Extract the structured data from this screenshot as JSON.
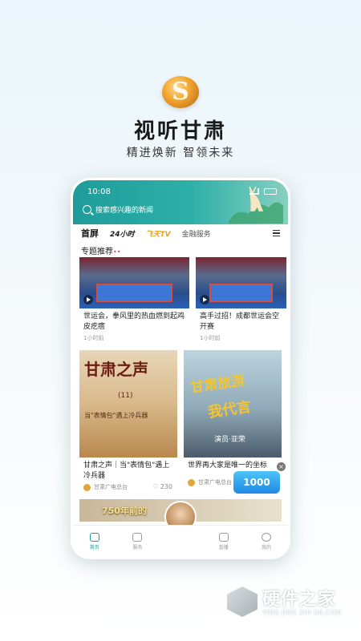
{
  "splash": {
    "app_title": "视听甘肃",
    "slogan": "精进焕新 智领未来"
  },
  "phone": {
    "status_time": "10:08",
    "search_placeholder": "搜索感兴趣的新闻",
    "tabs": [
      {
        "label": "首屏",
        "active": true
      },
      {
        "label": "24小时",
        "active": false
      },
      {
        "label": "飞天TV",
        "active": false
      },
      {
        "label": "金融服务",
        "active": false
      }
    ],
    "section_title": "专题推荐",
    "cards": [
      {
        "title": "世运会，拳风里的热血燃到起鸡皮疙瘩",
        "time": "1小时前"
      },
      {
        "title": "高手过招！成都世运会空开赛",
        "time": "1小时前"
      },
      {
        "poster_big": "甘肃之声",
        "poster_sub": "(11)",
        "poster_line": "当\"表情包\"遇上冷兵器",
        "title": "甘肃之声｜当\"表情包\"遇上冷兵器",
        "source": "甘肃广电总台",
        "likes": "230"
      },
      {
        "poster_big": "甘肃旅游",
        "poster_big2": "我代言",
        "poster_loc": "演员·亚荣",
        "title": "世界再大家是唯一的坐标",
        "source": "甘肃广电总台"
      }
    ],
    "promo_badge": "1000",
    "bottom_strip_text": "750年前的",
    "bottom_tabs": [
      {
        "label": "首页",
        "active": true
      },
      {
        "label": "服务",
        "active": false
      },
      {
        "label": "直播",
        "active": false
      },
      {
        "label": "我的",
        "active": false
      }
    ]
  },
  "watermark": {
    "name": "硬件之家",
    "pinyin": "YING JIAN ZHI JIA.COM"
  },
  "colors": {
    "accent": "#1f9c9a",
    "tv_tab": "#e0a21a"
  }
}
